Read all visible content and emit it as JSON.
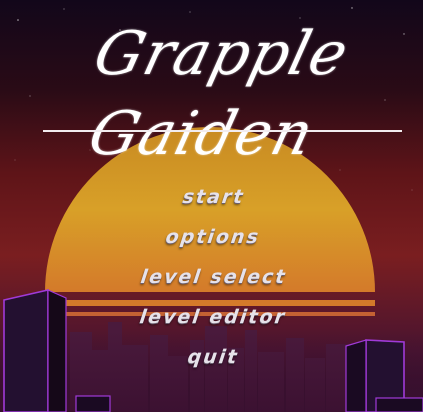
{
  "game": {
    "title": "Grapple Gaiden"
  },
  "menu": {
    "items": [
      {
        "label": "Start"
      },
      {
        "label": "Options"
      },
      {
        "label": "Level Select"
      },
      {
        "label": "Level Editor"
      },
      {
        "label": "Quit"
      }
    ]
  },
  "colors": {
    "sky_top": "#12071a",
    "sky_mid": "#7a1e20",
    "sun": "#d8a028",
    "neon_outline": "#a03ad8",
    "text": "#ffffff"
  }
}
